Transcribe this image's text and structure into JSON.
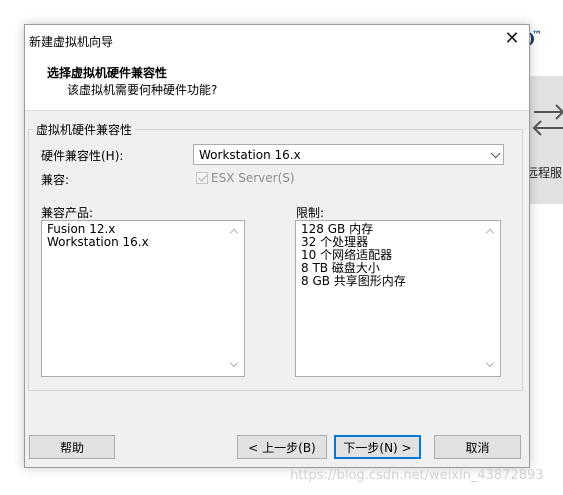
{
  "background_window": {
    "trademark": "™",
    "label": "远程服"
  },
  "dialog": {
    "title": "新建虚拟机向导",
    "close_glyph": "✕",
    "header": {
      "title": "选择虚拟机硬件兼容性",
      "subtitle": "该虚拟机需要何种硬件功能?"
    },
    "group": {
      "legend": "虚拟机硬件兼容性",
      "hardware_compat_label": "硬件兼容性(H):",
      "hardware_compat_value": "Workstation 16.x",
      "compatible_label": "兼容:",
      "esx_checkbox_label": "ESX Server(S)",
      "esx_checked": true,
      "products_label": "兼容产品:",
      "products": [
        "Fusion 12.x",
        "Workstation 16.x"
      ],
      "limits_label": "限制:",
      "limits": [
        "128 GB 内存",
        "32 个处理器",
        "10 个网络适配器",
        "8 TB 磁盘大小",
        "8 GB 共享图形内存"
      ]
    },
    "buttons": {
      "help": "帮助",
      "back": "< 上一步(B)",
      "next": "下一步(N) >",
      "cancel": "取消"
    }
  },
  "watermark": "https://blog.csdn.net/weixin_43872893",
  "colors": {
    "dialog_bg": "#f0f0f0",
    "default_button_border": "#0078d7",
    "disabled_text": "#8c8c8c"
  }
}
